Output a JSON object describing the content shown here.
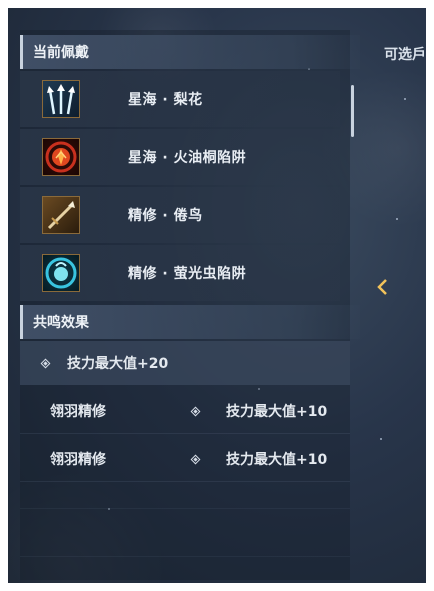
{
  "equipped": {
    "header": "当前佩戴",
    "items": [
      {
        "name": "星海 · 梨花",
        "icon": "arrows-icon"
      },
      {
        "name": "星海 · 火油桐陷阱",
        "icon": "fire-trap-icon"
      },
      {
        "name": "精修 · 倦鸟",
        "icon": "spear-icon"
      },
      {
        "name": "精修 · 萤光虫陷阱",
        "icon": "firefly-trap-icon"
      }
    ]
  },
  "resonance": {
    "header": "共鸣效果",
    "main_bonus": "技力最大值+20",
    "rows": [
      {
        "source": "翎羽精修",
        "bonus": "技力最大值+10"
      },
      {
        "source": "翎羽精修",
        "bonus": "技力最大值+10"
      }
    ]
  },
  "selectable_label": "可选戶",
  "colors": {
    "accent": "#c9d3df",
    "text": "#e8edf3",
    "panel": "#28354a"
  }
}
